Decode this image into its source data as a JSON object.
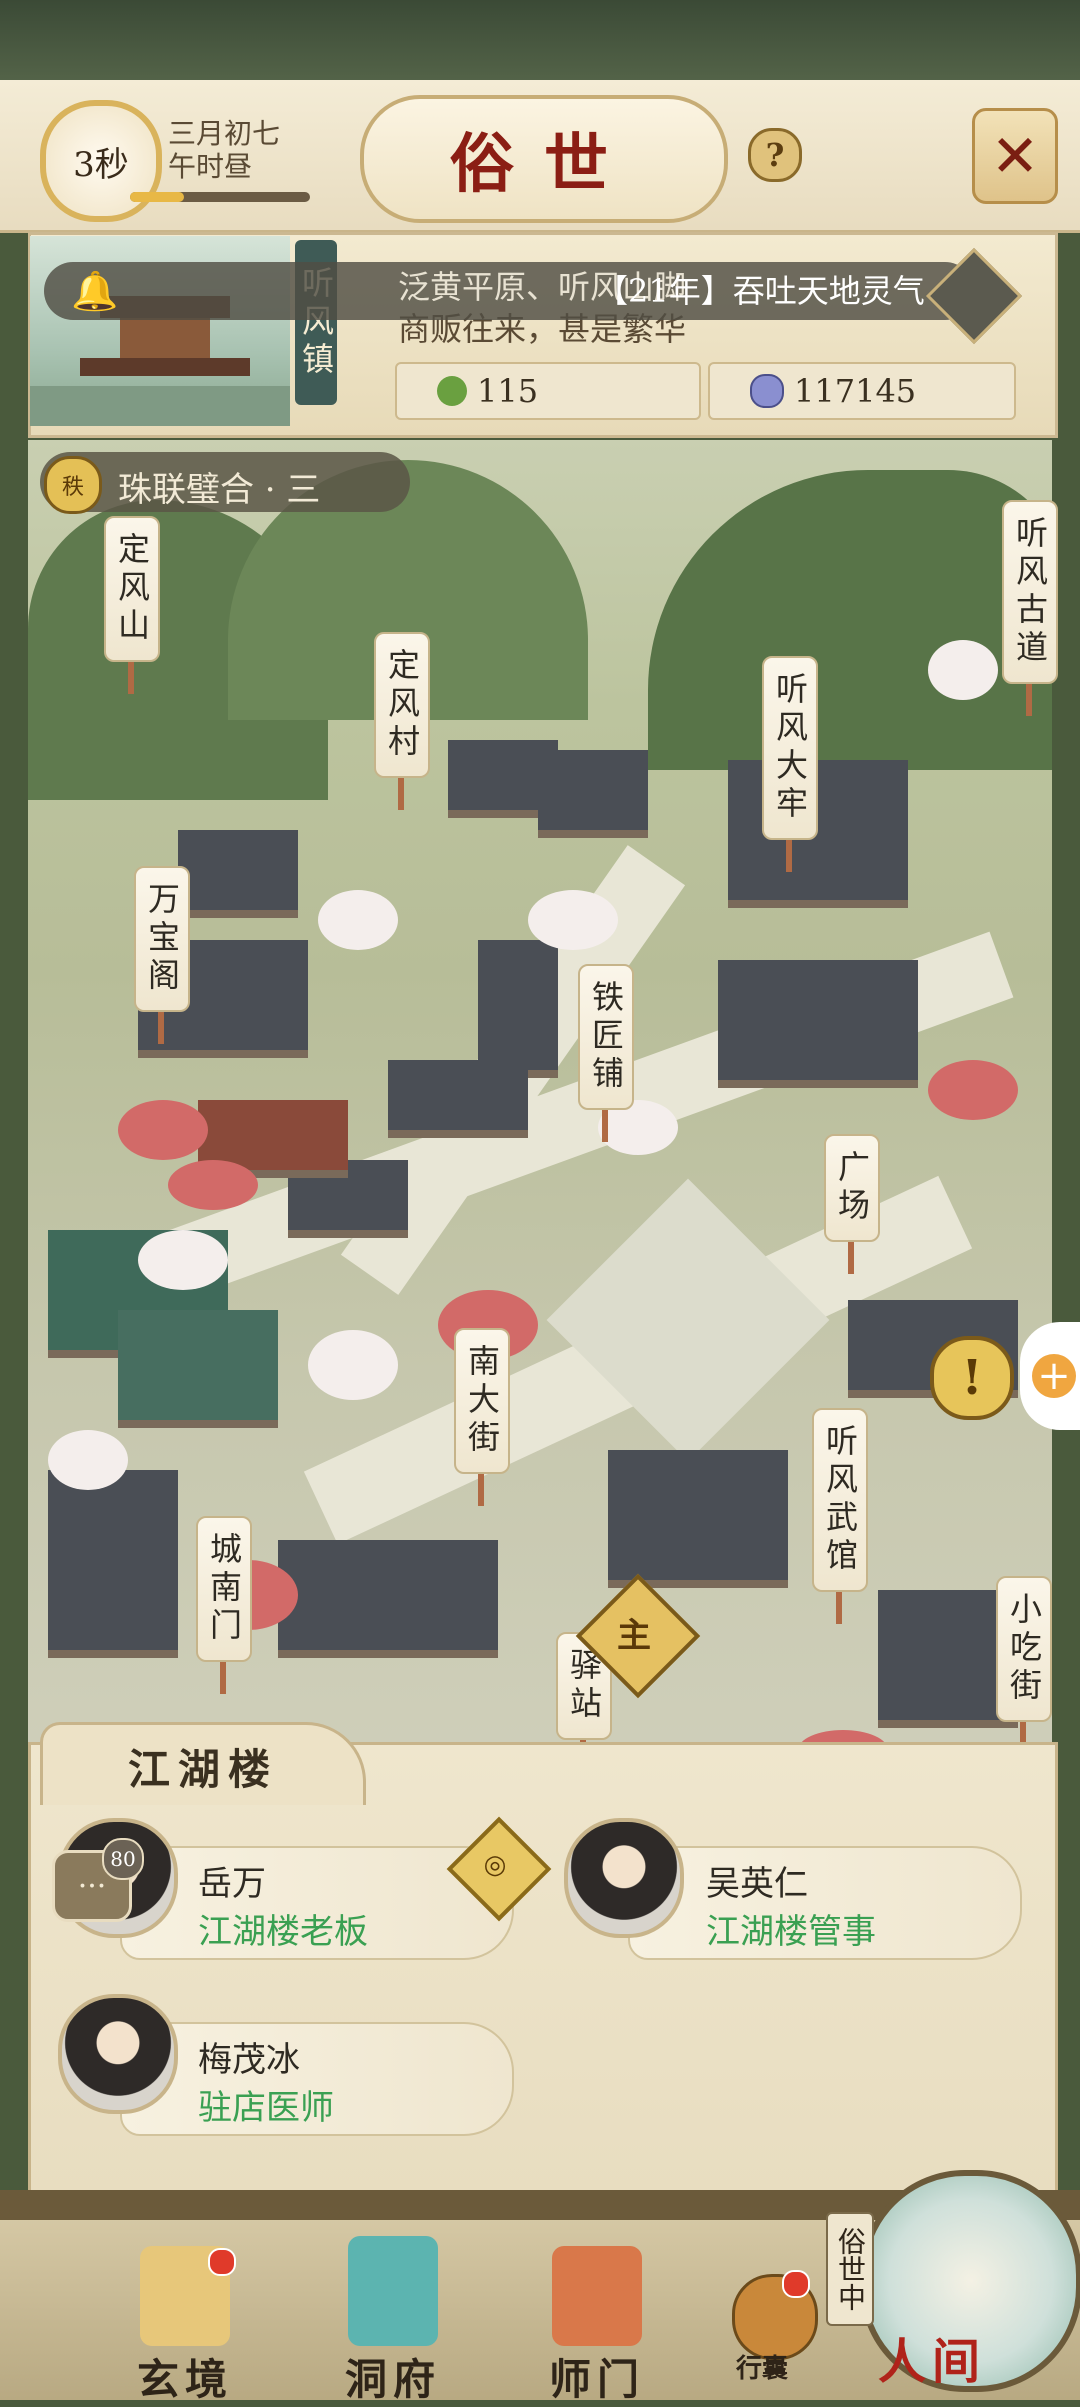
{
  "header": {
    "timer": "3秒",
    "date_line1": "三月初七",
    "date_line2": "午时昼",
    "time_progress": 0.3,
    "title": "俗世",
    "help_icon": "question-icon",
    "close_icon": "crossed-swords-icon"
  },
  "banner": {
    "location_name": "听风镇",
    "description_line1": "泛黄平原、听风山脚",
    "description_line2": "商贩往来，甚是繁华",
    "announcement": "【21年】吞吐天地灵气",
    "resources": [
      {
        "icon": "leaf-icon",
        "value": "115"
      },
      {
        "icon": "spirit-coin-icon",
        "value": "117145"
      }
    ]
  },
  "map": {
    "tier_badge": "秩",
    "tier_text": "珠联璧合 · 三",
    "locations": [
      "定风山",
      "定风村",
      "听风古道",
      "听风大牢",
      "万宝阁",
      "铁匠铺",
      "广场",
      "南大街",
      "听风武馆",
      "城南门",
      "驿站",
      "小吃街"
    ],
    "main_marker": "主"
  },
  "panel": {
    "title": "江湖楼",
    "npcs": [
      {
        "name": "岳万",
        "role": "江湖楼老板"
      },
      {
        "name": "吴英仁",
        "role": "江湖楼管事"
      },
      {
        "name": "梅茂冰",
        "role": "驻店医师"
      }
    ],
    "chat_count": "80"
  },
  "nav": {
    "items": [
      "玄境",
      "洞府",
      "师门"
    ],
    "bag_label": "行囊",
    "world_tag": "俗世中",
    "world_label": "人间"
  },
  "colors": {
    "title_red": "#8b1e14",
    "role_green": "#3aa052",
    "badge_gold": "#e5c162"
  }
}
